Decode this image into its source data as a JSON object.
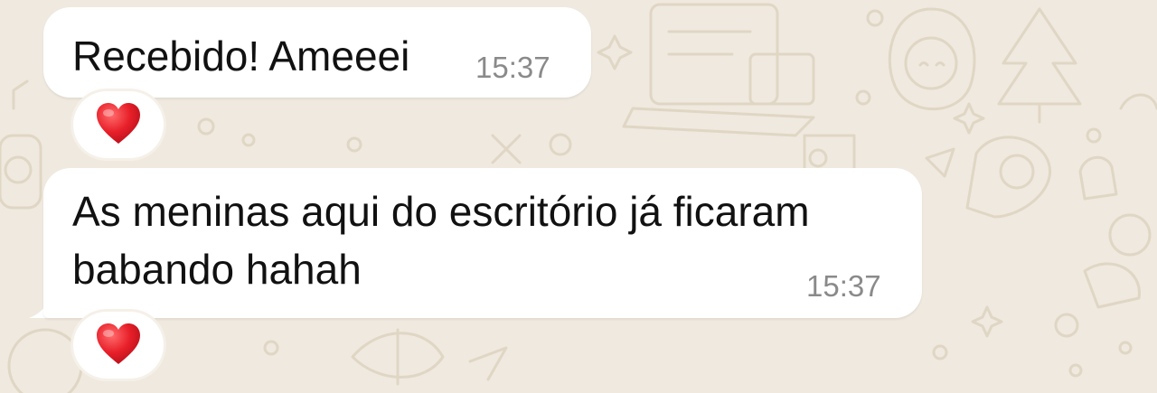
{
  "chat": {
    "messages": [
      {
        "lines": [
          "Recebido! Ameeei"
        ],
        "time": "15:37",
        "reaction": "heart-emoji"
      },
      {
        "lines": [
          "As meninas aqui do escritório já ficaram",
          "babando hahah"
        ],
        "time": "15:37",
        "reaction": "heart-emoji"
      }
    ]
  },
  "colors": {
    "wallpaper": "#efe9df",
    "doodle": "#e3dac9",
    "bubble": "#ffffff",
    "text": "#111111",
    "timestamp": "#8a8a8a",
    "heart": "#e8202a"
  }
}
